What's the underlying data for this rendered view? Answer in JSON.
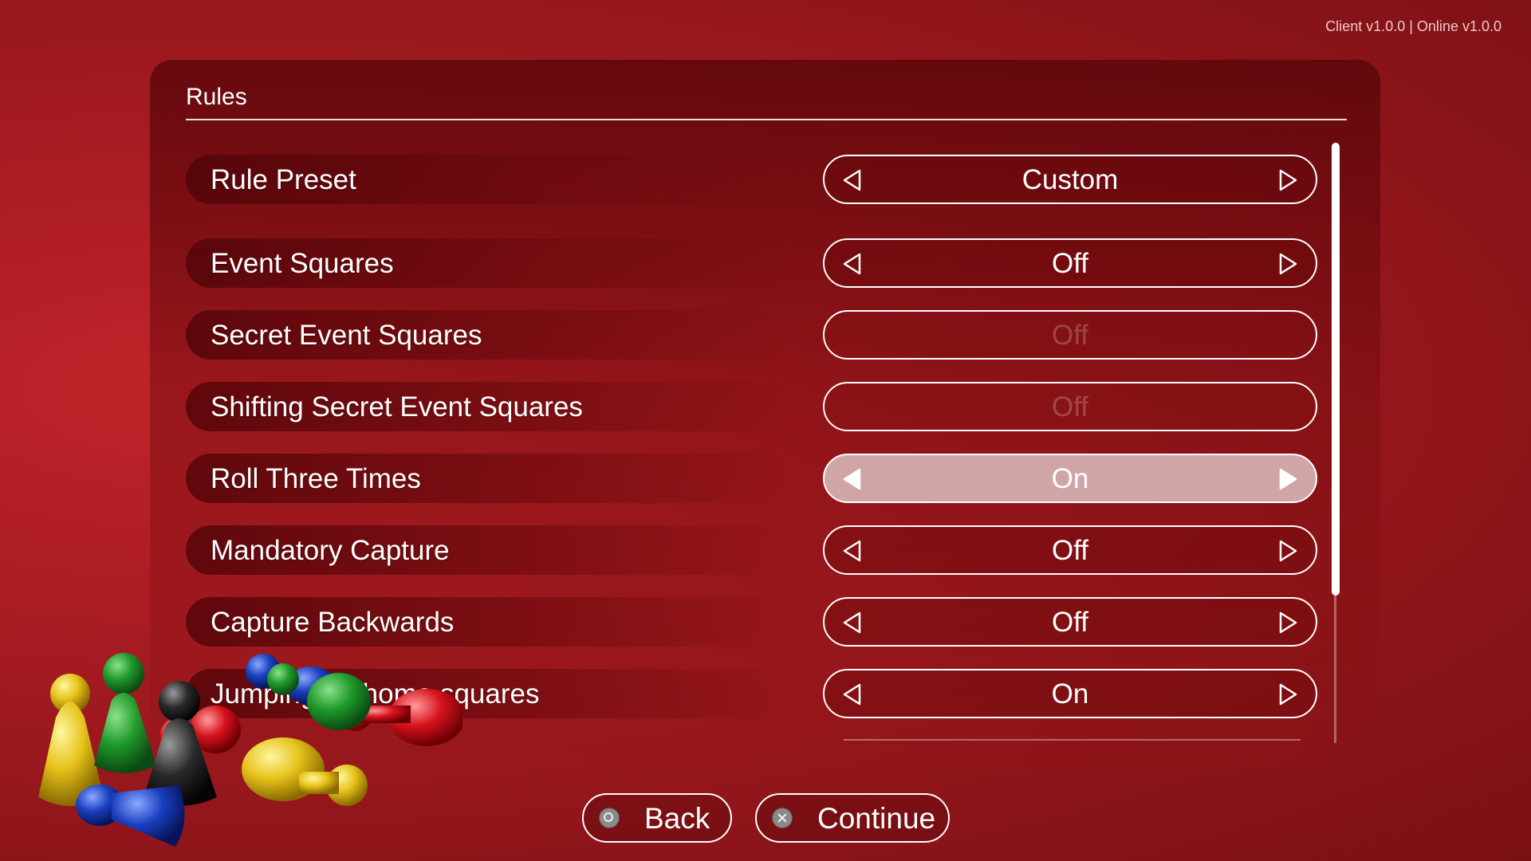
{
  "version_text": "Client v1.0.0 | Online v1.0.0",
  "panel": {
    "title": "Rules"
  },
  "rows": [
    {
      "label": "Rule Preset",
      "value": "Custom",
      "state": "normal"
    },
    {
      "label": "Event Squares",
      "value": "Off",
      "state": "normal"
    },
    {
      "label": "Secret Event Squares",
      "value": "Off",
      "state": "disabled"
    },
    {
      "label": "Shifting Secret Event Squares",
      "value": "Off",
      "state": "disabled"
    },
    {
      "label": "Roll Three Times",
      "value": "On",
      "state": "focused"
    },
    {
      "label": "Mandatory Capture",
      "value": "Off",
      "state": "normal"
    },
    {
      "label": "Capture Backwards",
      "value": "Off",
      "state": "normal"
    },
    {
      "label": "Jumping on home squares",
      "value": "On",
      "state": "normal"
    }
  ],
  "buttons": {
    "back": {
      "label": "Back",
      "icon": "circle-button-icon"
    },
    "continue": {
      "label": "Continue",
      "icon": "cross-button-icon"
    }
  },
  "colors": {
    "background": "#a81c22",
    "panel": "#6e0a0e",
    "focused_selector": "#d0a5a6",
    "text": "#ffffff"
  },
  "decoration": {
    "game_pieces": [
      "yellow",
      "green",
      "red",
      "black",
      "blue",
      "yellow",
      "green",
      "blue",
      "red"
    ]
  }
}
